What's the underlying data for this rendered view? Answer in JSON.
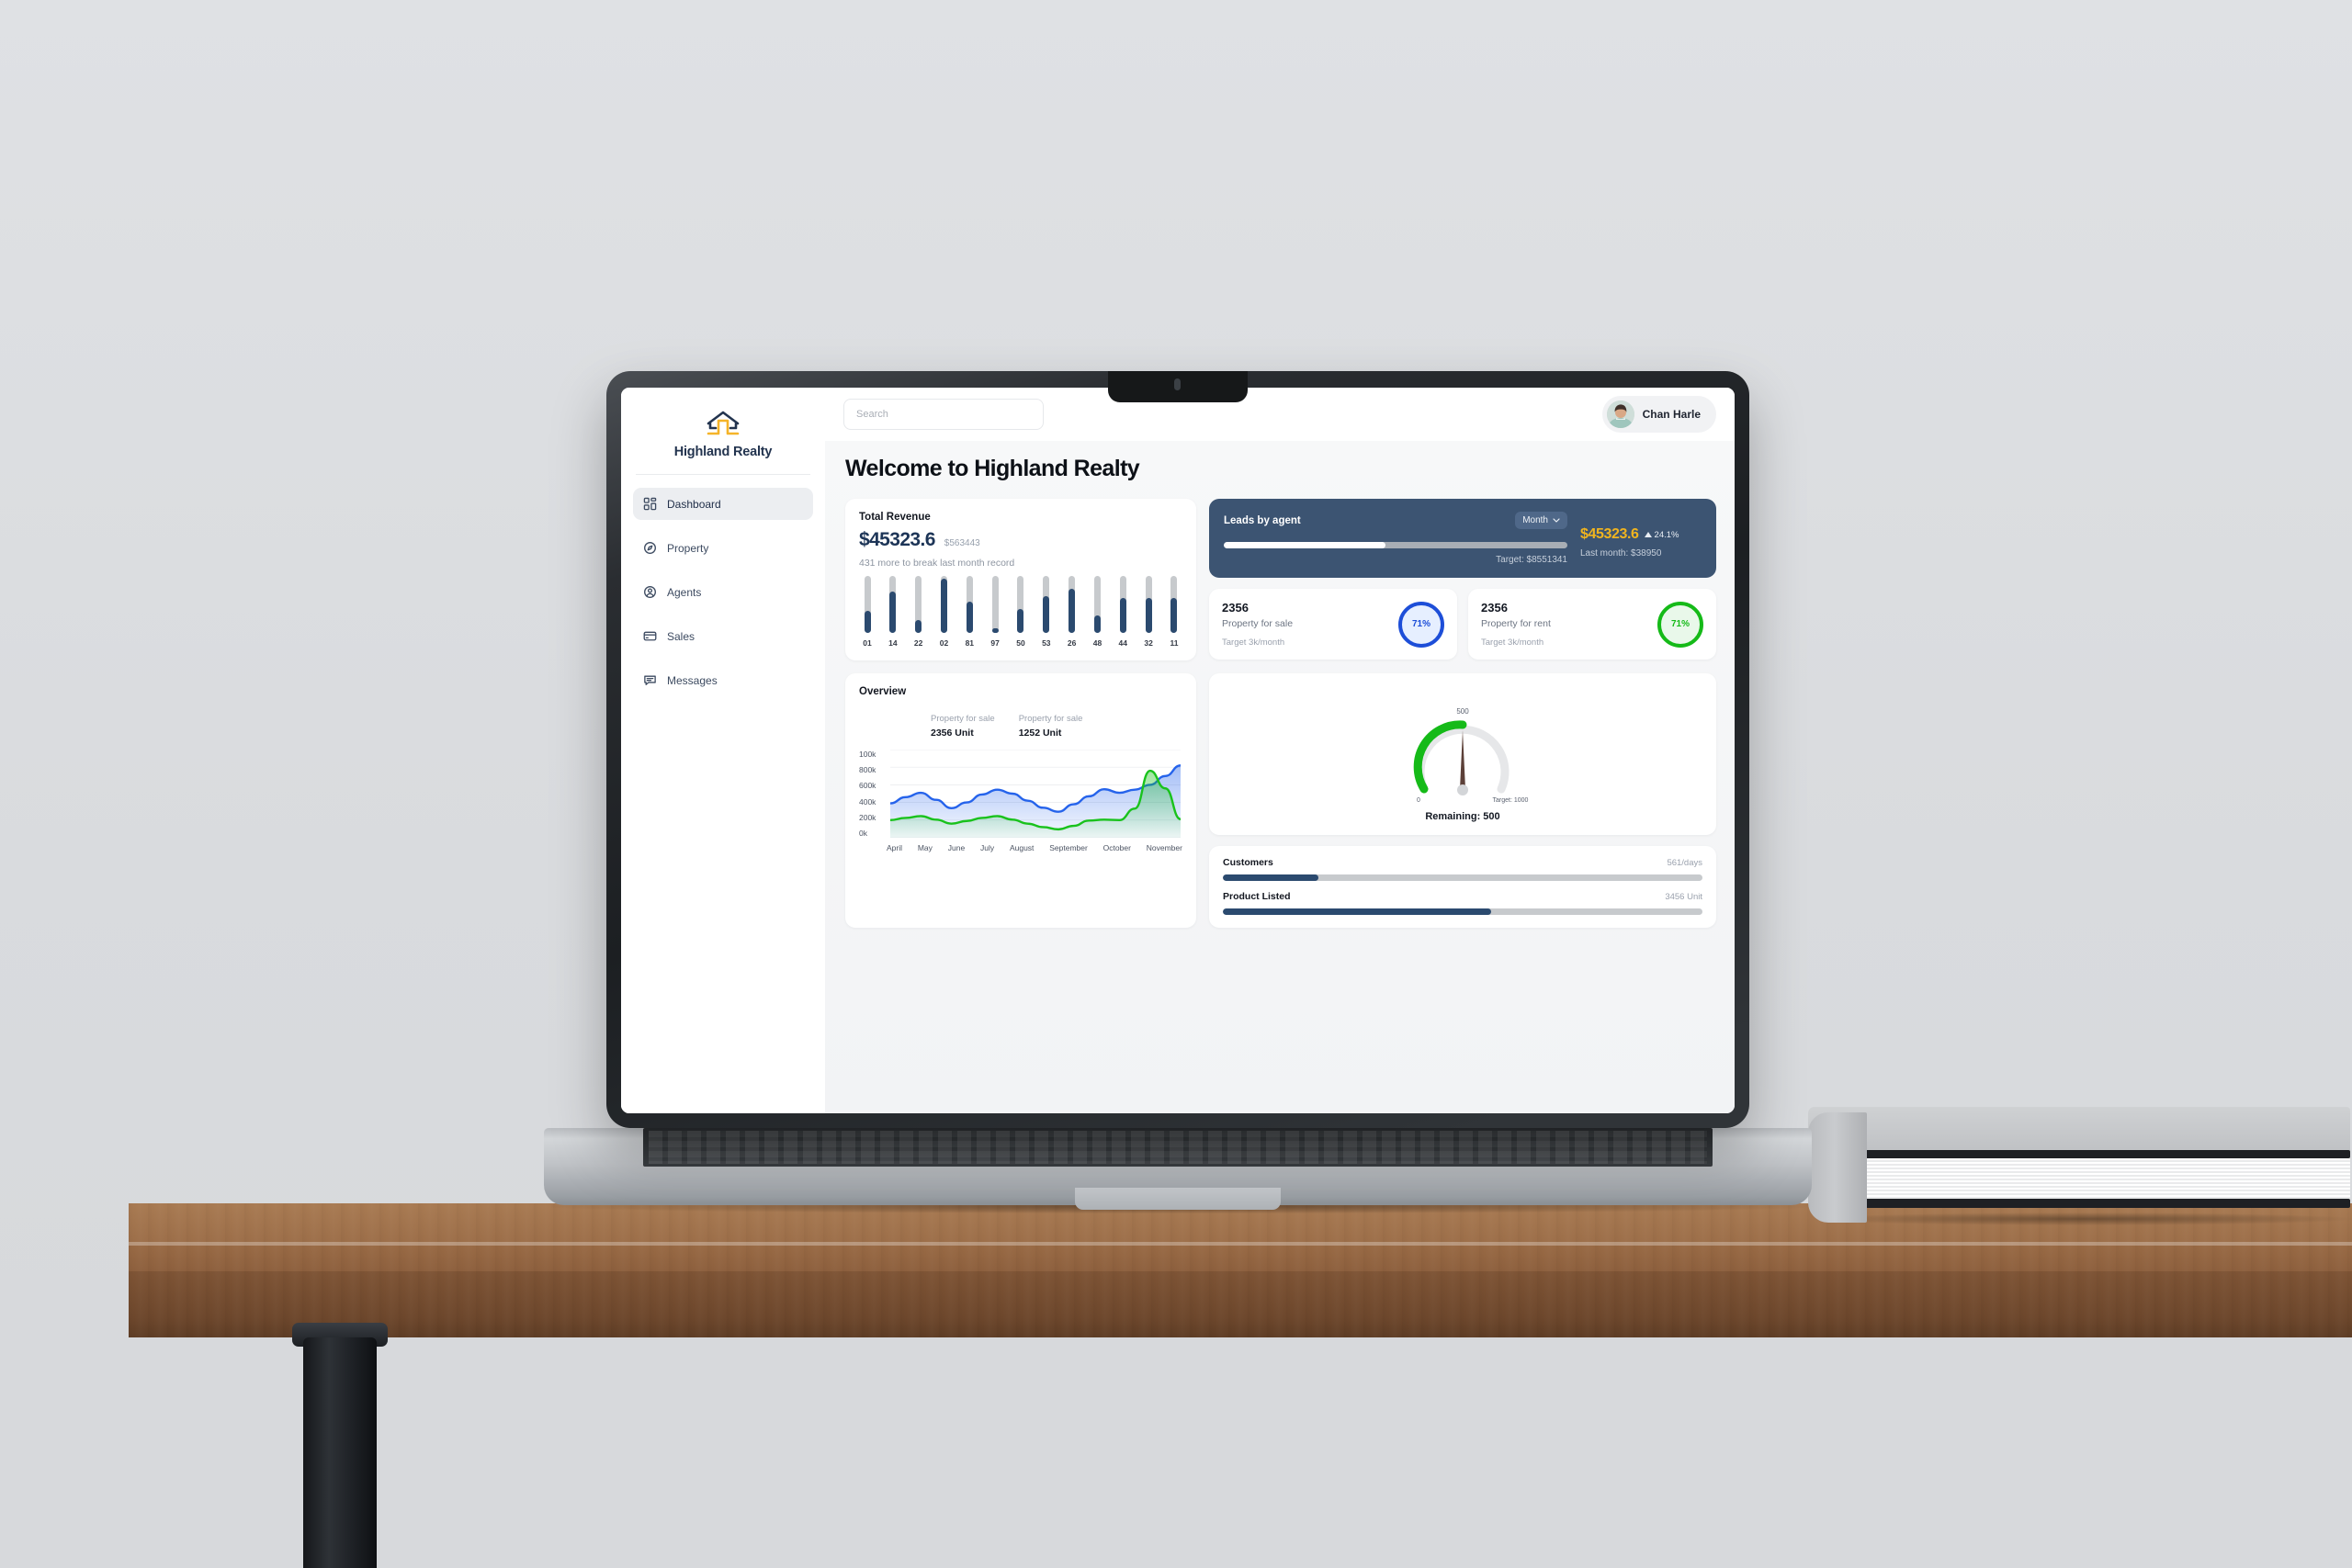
{
  "sidebar": {
    "brand_name": "Highland Realty",
    "items": [
      {
        "label": "Dashboard",
        "icon": "grid-icon",
        "active": true
      },
      {
        "label": "Property",
        "icon": "compass-icon",
        "active": false
      },
      {
        "label": "Agents",
        "icon": "user-circle-icon",
        "active": false
      },
      {
        "label": "Sales",
        "icon": "credit-card-icon",
        "active": false
      },
      {
        "label": "Messages",
        "icon": "chat-bubble-icon",
        "active": false
      }
    ]
  },
  "topbar": {
    "search_placeholder": "Search",
    "user_name": "Chan Harle"
  },
  "page": {
    "title": "Welcome to Highland Realty"
  },
  "total_revenue": {
    "title": "Total Revenue",
    "amount": "$45323.6",
    "secondary_amount": "$563443",
    "note": "431 more to break last month record"
  },
  "leads": {
    "title": "Leads by agent",
    "period": "Month",
    "amount": "$45323.6",
    "delta": "24.1%",
    "delta_direction": "up",
    "last_month": "Last month: $38950",
    "target": "Target: $8551341",
    "progress_percent": 47,
    "accent_color": "#f0b41f"
  },
  "property_cards": [
    {
      "count": "2356",
      "label": "Property for sale",
      "target": "Target 3k/month",
      "percent": "71%",
      "color": "#1d4ed8",
      "ring_class": "blue"
    },
    {
      "count": "2356",
      "label": "Property for rent",
      "target": "Target 3k/month",
      "percent": "71%",
      "color": "#15ba18",
      "ring_class": "green"
    }
  ],
  "overview": {
    "title": "Overview",
    "legend": [
      {
        "label": "Property for sale",
        "value": "2356 Unit"
      },
      {
        "label": "Property for sale",
        "value": "1252 Unit"
      }
    ]
  },
  "gauge": {
    "value_label": "500",
    "min_label": "0",
    "target_label": "Target: 1000",
    "remaining": "Remaining: 500",
    "value": 500,
    "max": 1000,
    "arc_color": "#15ba18"
  },
  "stats": [
    {
      "name": "Customers",
      "value": "561/days",
      "percent": 20
    },
    {
      "name": "Product Listed",
      "value": "3456 Unit",
      "percent": 56
    }
  ],
  "chart_data": [
    {
      "type": "bar",
      "title": "Total Revenue",
      "categories": [
        "01",
        "14",
        "22",
        "02",
        "81",
        "97",
        "50",
        "53",
        "26",
        "48",
        "44",
        "32",
        "11"
      ],
      "values": [
        38,
        72,
        22,
        95,
        55,
        8,
        42,
        65,
        78,
        30,
        62,
        62,
        62
      ],
      "ylim": [
        0,
        100
      ],
      "ylabel": "",
      "xlabel": "",
      "grid": false,
      "series_color": "#2b4a6f",
      "track_color": "#c7cacd"
    },
    {
      "type": "area",
      "title": "Overview",
      "x": [
        "April",
        "May",
        "June",
        "July",
        "August",
        "September",
        "October",
        "November"
      ],
      "ytick_labels": [
        "100k",
        "800k",
        "600k",
        "400k",
        "200k",
        "0k"
      ],
      "ylim": [
        0,
        1000
      ],
      "grid": true,
      "legend_position": "top",
      "series": [
        {
          "name": "Property for sale",
          "color": "#2563eb",
          "values": [
            390,
            460,
            510,
            430,
            335,
            400,
            490,
            545,
            500,
            420,
            340,
            295,
            380,
            470,
            550,
            510,
            545,
            600,
            700,
            820
          ]
        },
        {
          "name": "Property for sale",
          "color": "#19c21c",
          "values": [
            200,
            225,
            245,
            205,
            160,
            190,
            225,
            245,
            205,
            160,
            120,
            95,
            135,
            195,
            205,
            200,
            330,
            760,
            560,
            210
          ]
        }
      ]
    },
    {
      "type": "gauge",
      "title": "Remaining: 500",
      "value": 500,
      "min": 0,
      "max": 1000,
      "arc_color": "#15ba18",
      "track_color": "#e6e7e9"
    }
  ]
}
